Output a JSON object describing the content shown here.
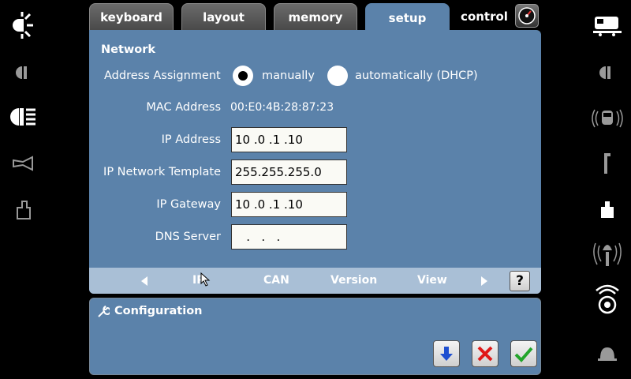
{
  "tabs": {
    "keyboard": "keyboard",
    "layout": "layout",
    "memory": "memory",
    "setup": "setup",
    "control": "control"
  },
  "network": {
    "title": "Network",
    "address_assignment_label": "Address Assignment",
    "option_manual": "manually",
    "option_dhcp": "automatically (DHCP)",
    "mac_label": "MAC Address",
    "mac_value": "00:E0:4B:28:87:23",
    "ip_label": "IP Address",
    "ip_value": "10 .0  .1  .10",
    "netmask_label": "IP Network Template",
    "netmask_value": "255.255.255.0",
    "gateway_label": "IP Gateway",
    "gateway_value": "10 .0  .1  .10",
    "dns_label": "DNS Server",
    "dns_value": "   .   .   ."
  },
  "subnav": {
    "items": [
      "IP",
      "CAN",
      "Version",
      "View"
    ],
    "help": "?"
  },
  "config": {
    "title": "Configuration"
  }
}
